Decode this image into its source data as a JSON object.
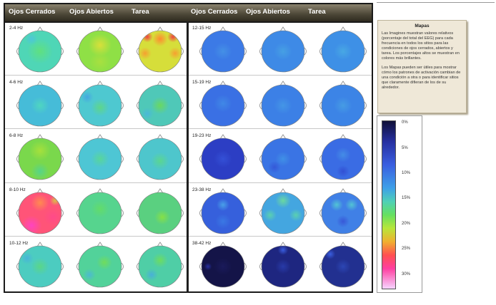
{
  "header": {
    "labels": [
      "Ojos Cerrados",
      "Ojos Abiertos",
      "Tarea",
      "Ojos Cerrados",
      "Ojos Abiertos",
      "Tarea"
    ]
  },
  "left_rows": [
    {
      "freq": "2-4 Hz",
      "maps": [
        {
          "base": "#4fd6b6",
          "spots": [
            [
              "#5fe080",
              0.5,
              0.5,
              0.5
            ],
            [
              "#4ec6d8",
              0.3,
              0.2,
              0.25
            ]
          ]
        },
        {
          "base": "#8fe046",
          "spots": [
            [
              "#d8e03a",
              0.5,
              0.35,
              0.45
            ],
            [
              "#a8e040",
              0.5,
              0.75,
              0.4
            ]
          ]
        },
        {
          "base": "#d6de3a",
          "spots": [
            [
              "#f04040",
              0.2,
              0.15,
              0.22
            ],
            [
              "#f04040",
              0.8,
              0.15,
              0.22
            ],
            [
              "#ff8a30",
              0.5,
              0.2,
              0.3
            ],
            [
              "#f6a030",
              0.15,
              0.55,
              0.25
            ],
            [
              "#f6a030",
              0.85,
              0.55,
              0.25
            ]
          ]
        }
      ]
    },
    {
      "freq": "4-6 Hz",
      "maps": [
        {
          "base": "#46bcd8",
          "spots": [
            [
              "#4fd6c0",
              0.5,
              0.5,
              0.35
            ]
          ]
        },
        {
          "base": "#4ec8d0",
          "spots": [
            [
              "#5ed68a",
              0.5,
              0.55,
              0.35
            ],
            [
              "#46a8e0",
              0.2,
              0.3,
              0.25
            ]
          ]
        },
        {
          "base": "#4fc8b8",
          "spots": [
            [
              "#6ad860",
              0.5,
              0.5,
              0.35
            ],
            [
              "#4ab8d8",
              0.2,
              0.7,
              0.25
            ]
          ]
        }
      ]
    },
    {
      "freq": "6-8 Hz",
      "maps": [
        {
          "base": "#7ad84c",
          "spots": [
            [
              "#a6e03c",
              0.5,
              0.3,
              0.4
            ],
            [
              "#56d48a",
              0.5,
              0.8,
              0.35
            ]
          ]
        },
        {
          "base": "#4ec6d4",
          "spots": [
            [
              "#58d69a",
              0.5,
              0.5,
              0.35
            ]
          ]
        },
        {
          "base": "#4ec6cc",
          "spots": [
            [
              "#5ad690",
              0.5,
              0.55,
              0.35
            ]
          ]
        }
      ]
    },
    {
      "freq": "8-10 Hz",
      "maps": [
        {
          "base": "#ff5478",
          "spots": [
            [
              "#ff44c0",
              0.3,
              0.8,
              0.4
            ],
            [
              "#ff8a50",
              0.5,
              0.25,
              0.35
            ],
            [
              "#ff4a8a",
              0.8,
              0.6,
              0.35
            ],
            [
              "#d8c048",
              0.85,
              0.2,
              0.2
            ]
          ]
        },
        {
          "base": "#56d48e",
          "spots": [
            [
              "#62dc6a",
              0.5,
              0.4,
              0.35
            ]
          ]
        },
        {
          "base": "#5ad080",
          "spots": [
            [
              "#86e046",
              0.55,
              0.6,
              0.3
            ]
          ]
        }
      ]
    },
    {
      "freq": "10-12 Hz",
      "maps": [
        {
          "base": "#4cccc0",
          "spots": [
            [
              "#5ad688",
              0.5,
              0.5,
              0.35
            ],
            [
              "#48b4d8",
              0.2,
              0.3,
              0.25
            ]
          ]
        },
        {
          "base": "#52d29a",
          "spots": [
            [
              "#70dc5c",
              0.6,
              0.4,
              0.3
            ],
            [
              "#4cbad0",
              0.25,
              0.7,
              0.25
            ]
          ]
        },
        {
          "base": "#4fcea6",
          "spots": [
            [
              "#6cdc60",
              0.5,
              0.35,
              0.3
            ],
            [
              "#48b0d8",
              0.3,
              0.7,
              0.25
            ]
          ]
        }
      ]
    }
  ],
  "right_rows": [
    {
      "freq": "12-15 Hz",
      "maps": [
        {
          "base": "#3c7ae6",
          "spots": [
            [
              "#4490e6",
              0.5,
              0.5,
              0.35
            ]
          ]
        },
        {
          "base": "#3e8ae6",
          "spots": [
            [
              "#46a0e4",
              0.5,
              0.5,
              0.35
            ]
          ]
        },
        {
          "base": "#3e90e6",
          "spots": [
            [
              "#48a8e4",
              0.5,
              0.5,
              0.35
            ]
          ]
        }
      ]
    },
    {
      "freq": "15-19 Hz",
      "maps": [
        {
          "base": "#3a70e4",
          "spots": [
            [
              "#4088e6",
              0.5,
              0.45,
              0.35
            ]
          ]
        },
        {
          "base": "#3c80e6",
          "spots": [
            [
              "#4496e6",
              0.5,
              0.5,
              0.35
            ]
          ]
        },
        {
          "base": "#3c84e6",
          "spots": [
            [
              "#469ce4",
              0.5,
              0.5,
              0.35
            ]
          ]
        }
      ]
    },
    {
      "freq": "19-23 Hz",
      "maps": [
        {
          "base": "#2c3ec4",
          "spots": [
            [
              "#3450d6",
              0.5,
              0.5,
              0.35
            ]
          ]
        },
        {
          "base": "#3a74e4",
          "spots": [
            [
              "#4090e6",
              0.5,
              0.5,
              0.3
            ],
            [
              "#3458d8",
              0.3,
              0.7,
              0.25
            ]
          ]
        },
        {
          "base": "#3a6ce4",
          "spots": [
            [
              "#448ce6",
              0.5,
              0.4,
              0.3
            ],
            [
              "#3250d4",
              0.5,
              0.8,
              0.25
            ]
          ]
        }
      ]
    },
    {
      "freq": "23-38 Hz",
      "maps": [
        {
          "base": "#3660dc",
          "spots": [
            [
              "#48a0e8",
              0.5,
              0.3,
              0.25
            ],
            [
              "#3a78e4",
              0.5,
              0.7,
              0.3
            ]
          ]
        },
        {
          "base": "#44a6e0",
          "spots": [
            [
              "#6ad8a0",
              0.5,
              0.2,
              0.3
            ],
            [
              "#5ad0b0",
              0.2,
              0.55,
              0.25
            ],
            [
              "#5ad0b0",
              0.8,
              0.55,
              0.25
            ]
          ]
        },
        {
          "base": "#4080e6",
          "spots": [
            [
              "#52c4d4",
              0.35,
              0.3,
              0.25
            ],
            [
              "#52c4d4",
              0.7,
              0.3,
              0.25
            ],
            [
              "#3858d8",
              0.5,
              0.7,
              0.25
            ]
          ]
        }
      ]
    },
    {
      "freq": "38-42 Hz",
      "maps": [
        {
          "base": "#141448",
          "spots": [
            [
              "#1a1a5a",
              0.5,
              0.5,
              0.35
            ],
            [
              "#262f9f",
              0.15,
              0.5,
              0.15
            ]
          ]
        },
        {
          "base": "#1e2680",
          "spots": [
            [
              "#283aa8",
              0.5,
              0.5,
              0.3
            ],
            [
              "#3a5ee0",
              0.5,
              0.1,
              0.2
            ]
          ]
        },
        {
          "base": "#223090",
          "spots": [
            [
              "#2c46b4",
              0.5,
              0.5,
              0.3
            ],
            [
              "#3a5ee0",
              0.2,
              0.2,
              0.2
            ]
          ]
        }
      ]
    }
  ],
  "info": {
    "title": "Mapas",
    "p1": "Las Imagines muestran valores relativos (porcentaje del total del EEG) para cada frecuencia en todos los sitios para las condiciones de ojos cerrados, abiertos y tarea. Los porcentajes altos se muestran en colores más brillantes.",
    "p2": "Los Mapas pueden ser útiles para mostrar cómo los patrones de activación cambian de una condición a otra o para identificar sitios que claramente difieran de los de su alrededor."
  },
  "legend": {
    "ticks": [
      "0%",
      "5%",
      "10%",
      "15%",
      "20%",
      "25%",
      "30%"
    ]
  }
}
